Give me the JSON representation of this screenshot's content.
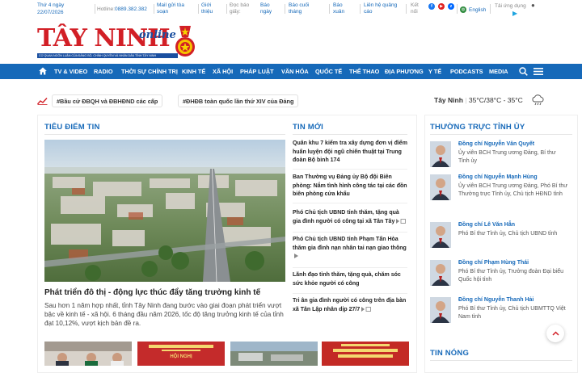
{
  "topbar": {
    "date_weekday": "Thứ 4 ngày",
    "date": "22/07/2026",
    "hotline_label": "Hotline:",
    "hotline_number": "0889.382.382",
    "links": [
      {
        "line1": "Mail gửi tòa",
        "line2": "soạn"
      },
      {
        "line1": "Giới",
        "line2": "thiệu"
      },
      {
        "line1": "Đọc báo",
        "line2": "giấy:"
      },
      {
        "line1": "Báo",
        "line2": "ngày"
      },
      {
        "line1": "Báo cuối",
        "line2": "tháng"
      },
      {
        "line1": "Báo",
        "line2": "xuân"
      },
      {
        "line1": "Liên hệ quảng",
        "line2": "cáo"
      },
      {
        "line1": "Kết",
        "line2": "nối"
      }
    ],
    "language": "English",
    "app_download": "Tải ứng dụng"
  },
  "header": {
    "logo_text": "TÂY NINH",
    "logo_suffix": "online",
    "logo_tagline": "CƠ QUAN NGÔN LUẬN CỦA ĐẢNG BỘ, CHÍNH QUYỀN VÀ NHÂN DÂN TỈNH TÂY NINH"
  },
  "nav": {
    "items": [
      "TV & VIDEO",
      "RADIO",
      "THỜI SỰ CHÍNH TRỊ",
      "KINH TẾ",
      "XÃ HỘI",
      "PHÁP LUẬT",
      "VĂN HÓA",
      "QUỐC TẾ",
      "THỂ THAO",
      "ĐỊA PHƯƠNG",
      "Y TẾ",
      "PODCASTS",
      "MEDIA"
    ]
  },
  "tags": {
    "items": [
      "#Bầu cử ĐBQH và ĐBHĐND các cấp",
      "#ĐHĐB toàn quốc lần thứ XIV của Đảng"
    ]
  },
  "weather": {
    "city": "Tây Ninh",
    "temp": "35°C/38°C - 35°C"
  },
  "focus": {
    "title": "TIÊU ĐIỂM TIN",
    "headline": "Phát triển đô thị - động lực thúc đẩy tăng trưởng kinh tế",
    "summary": "Sau hơn 1 năm hợp nhất, tỉnh Tây Ninh đang bước vào giai đoạn phát triển vượt bậc về kinh tế - xã hội. 6 tháng đầu năm 2026, tốc độ tăng trưởng kinh tế của tỉnh đạt 10,12%, vượt kịch bản đề ra."
  },
  "latest": {
    "title": "TIN MỚI",
    "items": [
      "Quân khu 7 kiểm tra xây dựng đơn vị điểm huấn luyện đội ngũ chiến thuật tại Trung đoàn Bộ binh 174",
      "Ban Thường vụ Đảng ủy Bộ đội Biên phòng: Nắm tình hình công tác tại các đồn biên phòng cửa khẩu",
      "Phó Chủ tịch UBND tỉnh thăm, tặng quà gia đình người có công tại xã Tân Tây",
      "Phó Chủ tịch UBND tỉnh Phạm Tấn Hòa thăm gia đình nạn nhân tai nạn giao thông",
      "Lãnh đạo tỉnh thăm, tặng quà, chăm sóc sức khỏe người có công",
      "Tri ân gia đình người có công trên địa bàn xã Tân Lập nhân dịp 27/7"
    ]
  },
  "standing": {
    "title": "THƯỜNG TRỰC TỈNH ỦY",
    "leaders": [
      {
        "name": "Đồng chí Nguyễn Văn Quyết",
        "role": "Ủy viên BCH Trung ương Đảng, Bí thư Tỉnh ủy"
      },
      {
        "name": "Đồng chí Nguyễn Mạnh Hùng",
        "role": "Ủy viên BCH Trung ương Đảng, Phó Bí thư Thường trực Tỉnh ủy, Chủ tịch HĐND tỉnh"
      },
      {
        "name": "Đồng chí Lê Văn Hẫn",
        "role": "Phó Bí thư Tỉnh ủy, Chủ tịch UBND tỉnh"
      },
      {
        "name": "Đồng chí Phạm Hùng Thái",
        "role": "Phó Bí thư Tỉnh ủy, Trưởng đoàn Đại biểu Quốc hội tỉnh"
      },
      {
        "name": "Đồng chí Nguyễn Thanh Hải",
        "role": "Phó Bí thư Tỉnh ủy, Chủ tịch UBMTTQ Việt Nam tỉnh"
      }
    ]
  },
  "hot": {
    "title": "TIN NÓNG"
  },
  "thumbs": {
    "banner_text": "HỘI NGHỊ"
  },
  "colors": {
    "brand_blue": "#1669b9",
    "logo_red": "#d21f26"
  }
}
